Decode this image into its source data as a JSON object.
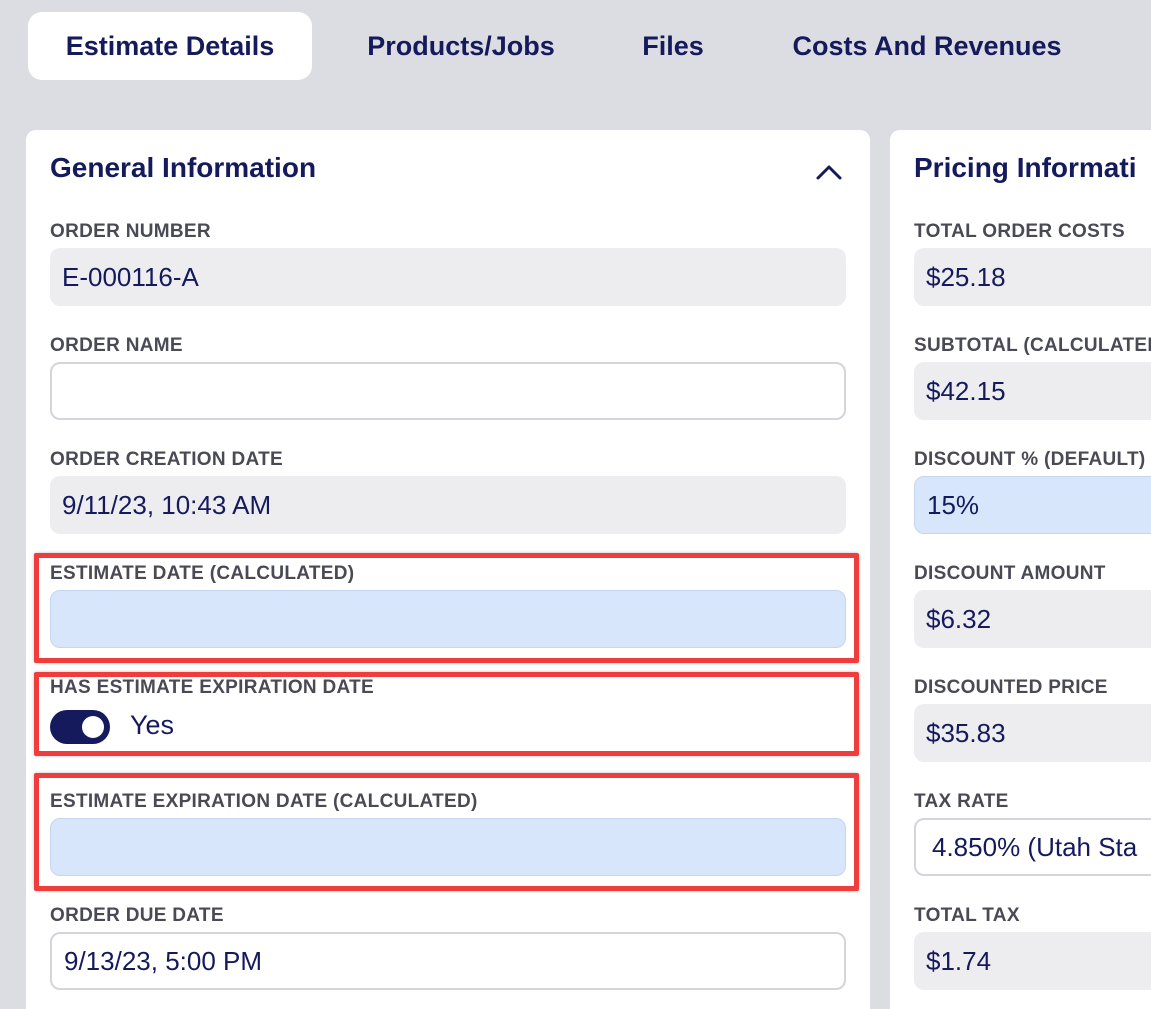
{
  "tabs": [
    {
      "label": "Estimate Details",
      "active": true
    },
    {
      "label": "Products/Jobs"
    },
    {
      "label": "Files"
    },
    {
      "label": "Costs And Revenues"
    }
  ],
  "general": {
    "title": "General Information",
    "collapse_icon": "chevron-up-icon",
    "order_number": {
      "label": "ORDER NUMBER",
      "value": "E-000116-A"
    },
    "order_name": {
      "label": "ORDER NAME",
      "value": ""
    },
    "order_creation_date": {
      "label": "ORDER CREATION DATE",
      "value": "9/11/23, 10:43 AM"
    },
    "estimate_date": {
      "label": "ESTIMATE DATE (CALCULATED)",
      "value": ""
    },
    "has_expiration": {
      "label": "HAS ESTIMATE EXPIRATION DATE",
      "value": "Yes",
      "on": true
    },
    "estimate_expiration_date": {
      "label": "ESTIMATE EXPIRATION DATE (CALCULATED)",
      "value": ""
    },
    "order_due_date": {
      "label": "ORDER DUE DATE",
      "value": "9/13/23, 5:00 PM"
    }
  },
  "pricing": {
    "title": "Pricing Informati",
    "total_order_costs": {
      "label": "TOTAL ORDER COSTS",
      "value": "$25.18"
    },
    "subtotal": {
      "label": "SUBTOTAL (CALCULATED",
      "value": "$42.15"
    },
    "discount_pct": {
      "label": "DISCOUNT % (DEFAULT)",
      "value": "15%"
    },
    "discount_amount": {
      "label": "DISCOUNT AMOUNT",
      "value": "$6.32"
    },
    "discounted_price": {
      "label": "DISCOUNTED PRICE",
      "value": "$35.83"
    },
    "tax_rate": {
      "label": "TAX RATE",
      "value": "4.850% (Utah Sta"
    },
    "total_tax": {
      "label": "TOTAL TAX",
      "value": "$1.74"
    }
  },
  "colors": {
    "accent": "#141a5c",
    "highlight": "#ef3c3c",
    "calculated_field": "#d8e6fb",
    "readonly_field": "#ededf0"
  }
}
